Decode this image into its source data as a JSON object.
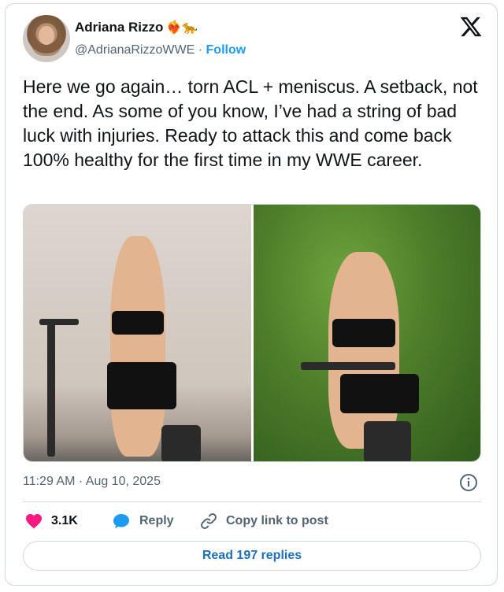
{
  "author": {
    "name": "Adriana Rizzo",
    "emojis": "❤️‍🔥🐆",
    "handle": "@AdrianaRizzoWWE",
    "separator": "·",
    "follow_label": "Follow"
  },
  "tweet": {
    "text": "Here we go again… torn ACL + meniscus. A setback, not the end. As some of you know, I’ve had a string of bad luck with injuries. Ready to attack this and come back 100% healthy for the first time in my WWE career."
  },
  "meta": {
    "time": "11:29 AM",
    "separator": "·",
    "date": "Aug 10, 2025"
  },
  "actions": {
    "likes": "3.1K",
    "reply_label": "Reply",
    "copy_label": "Copy link to post"
  },
  "footer": {
    "read_replies_label": "Read 197 replies"
  },
  "colors": {
    "accent": "#1d9bf0",
    "like": "#f91880",
    "muted": "#536471",
    "border": "#cfd9de"
  },
  "icons": [
    "x-logo-icon",
    "info-icon",
    "heart-icon",
    "reply-icon",
    "link-icon"
  ]
}
